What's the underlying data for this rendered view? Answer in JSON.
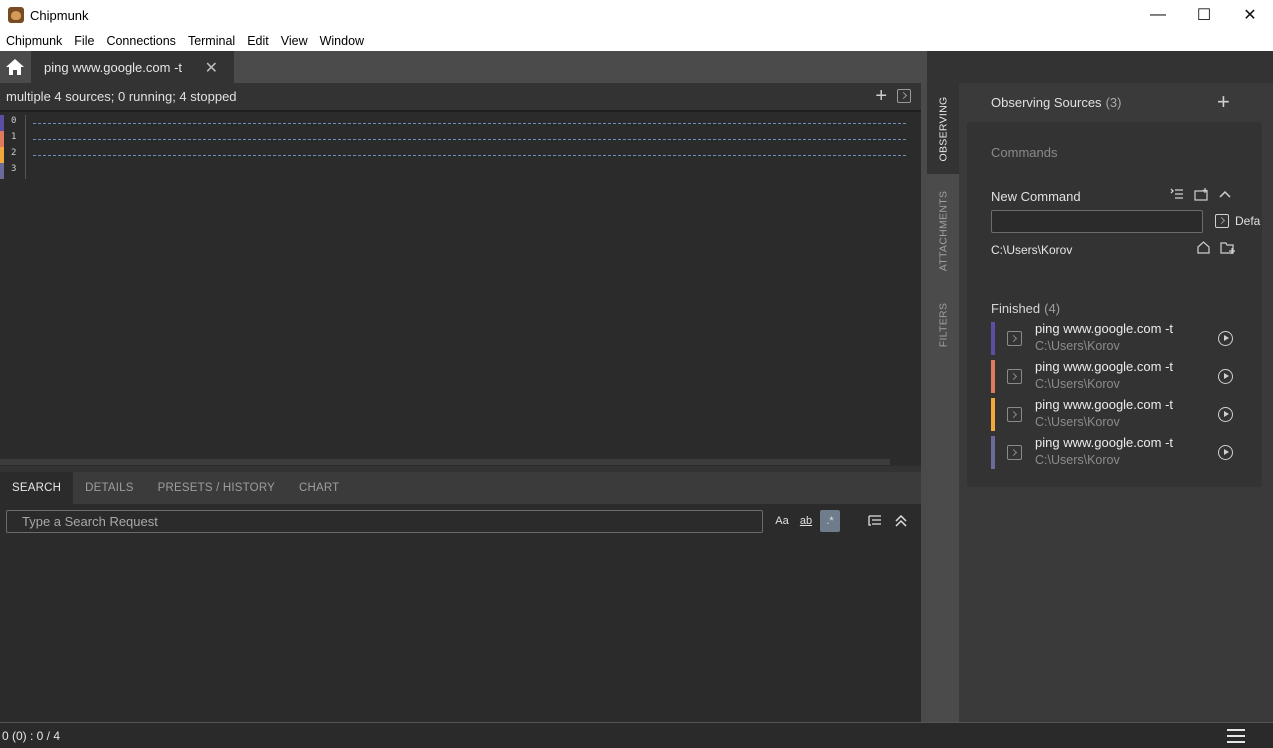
{
  "window": {
    "title": "Chipmunk",
    "controls": {
      "minimize": "—",
      "maximize": "☐",
      "close": "✕"
    }
  },
  "menu": [
    "Chipmunk",
    "File",
    "Connections",
    "Terminal",
    "Edit",
    "View",
    "Window"
  ],
  "tab": {
    "label": "ping www.google.com -t",
    "close": "✕"
  },
  "stream": {
    "summary": "multiple 4 sources; 0 running; 4 stopped",
    "rows": [
      {
        "num": "0",
        "color": "#5b4fa3"
      },
      {
        "num": "1",
        "color": "#e07a5f"
      },
      {
        "num": "2",
        "color": "#f2a93b"
      },
      {
        "num": "3",
        "color": "#6b6b9a"
      }
    ]
  },
  "lower_tabs": [
    "SEARCH",
    "DETAILS",
    "PRESETS / HISTORY",
    "CHART"
  ],
  "search": {
    "placeholder": "Type a Search Request",
    "opt_case": "Aa",
    "opt_word": "ab",
    "opt_regex": ".*"
  },
  "status": {
    "text": "0 (0) : 0 / 4"
  },
  "side_tabs": [
    "OBSERVING",
    "ATTACHMENTS",
    "FILTERS"
  ],
  "sidebar": {
    "title": "Observing Sources",
    "count": "(3)",
    "commands_label": "Commands",
    "new_command_label": "New Command",
    "default_label": "Defa",
    "cwd": "C:\\Users\\Korov",
    "finished_label": "Finished",
    "finished_count": "(4)",
    "finished": [
      {
        "cmd": "ping www.google.com -t",
        "path": "C:\\Users\\Korov",
        "color": "#5b4fa3"
      },
      {
        "cmd": "ping www.google.com -t",
        "path": "C:\\Users\\Korov",
        "color": "#e07a5f"
      },
      {
        "cmd": "ping www.google.com -t",
        "path": "C:\\Users\\Korov",
        "color": "#f2a93b"
      },
      {
        "cmd": "ping www.google.com -t",
        "path": "C:\\Users\\Korov",
        "color": "#6b6b9a"
      }
    ]
  }
}
